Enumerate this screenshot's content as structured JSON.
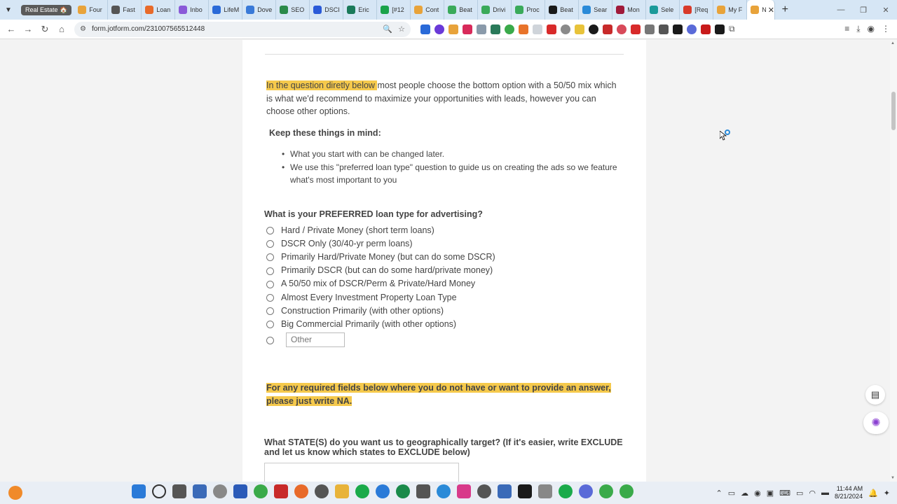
{
  "browser": {
    "tab_group_label": "Real Estate 🏠",
    "tabs": [
      {
        "label": "Four",
        "color": "#e8a33a"
      },
      {
        "label": "Fast",
        "color": "#555555"
      },
      {
        "label": "Loan",
        "color": "#e86a2a"
      },
      {
        "label": "Inbo",
        "color": "#8a5ad8"
      },
      {
        "label": "LifeM",
        "color": "#2a6ad8"
      },
      {
        "label": "Dove",
        "color": "#3a7ad8"
      },
      {
        "label": "SEO",
        "color": "#2a8a4a"
      },
      {
        "label": "DSCI",
        "color": "#2a5ad8"
      },
      {
        "label": "Eric",
        "color": "#1a7a5a"
      },
      {
        "label": "[#12",
        "color": "#1aa34a"
      },
      {
        "label": "Cont",
        "color": "#e8a33a"
      },
      {
        "label": "Beat",
        "color": "#3aaa5a"
      },
      {
        "label": "Drivi",
        "color": "#3aaa5a"
      },
      {
        "label": "Proc",
        "color": "#3aaa5a"
      },
      {
        "label": "Beat",
        "color": "#1a1a1a"
      },
      {
        "label": "Sear",
        "color": "#2a8ad8"
      },
      {
        "label": "Mon",
        "color": "#a01a3a"
      },
      {
        "label": "Sele",
        "color": "#1a9a9a"
      },
      {
        "label": "[Req",
        "color": "#d83a2a"
      },
      {
        "label": "My F",
        "color": "#e8a33a"
      },
      {
        "label": "N",
        "color": "#e8a33a",
        "active": true
      }
    ],
    "url": "form.jotform.com/231007565512448"
  },
  "form": {
    "intro_highlight": "In the question diretly below ",
    "intro_rest": "most people choose the bottom option with a 50/50 mix which is what we'd recommend to maximize your opportunities with leads, however you can choose other options.",
    "keep_heading": "Keep these things in mind:",
    "bullets": [
      "What you start with can be changed later.",
      "We use this \"preferred loan type\" question to guide us on creating the ads so we feature what's most important to you"
    ],
    "question1": "What is your PREFERRED loan type for advertising?",
    "options": [
      "Hard / Private Money (short term loans)",
      "DSCR Only (30/40-yr perm loans)",
      "Primarily Hard/Private Money (but can do some DSCR)",
      "Primarily DSCR (but can do some hard/private money)",
      "A 50/50 mix of DSCR/Perm & Private/Hard Money",
      "Almost Every Investment Property Loan Type",
      "Construction Primarily (with other options)",
      "Big Commercial Primarily (with other options)"
    ],
    "other_placeholder": "Other",
    "note": "For any required fields below where you do not have or want to provide an answer, please just write NA.",
    "question2": "What STATE(S) do you want us to geographically target? (If it's easier, write EXCLUDE and let us know which states to EXCLUDE below)"
  },
  "taskbar": {
    "time": "11:44 AM",
    "date": "8/21/2024"
  }
}
